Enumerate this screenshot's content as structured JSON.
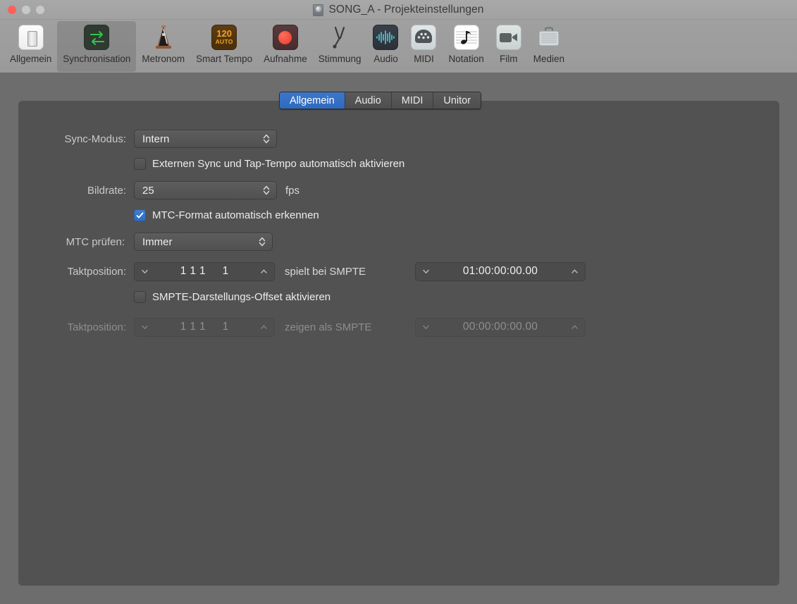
{
  "window": {
    "title": "SONG_A - Projekteinstellungen",
    "title_icon": "project-icon",
    "traffic_lights": [
      "close",
      "minimize",
      "maximize"
    ],
    "accent_color": "#3471c8",
    "panel_bg": "#525252",
    "toolbar_bg": "#9e9e9e"
  },
  "toolbar": {
    "items": [
      {
        "label": "Allgemein",
        "icon": "light-switch-icon",
        "selected": false
      },
      {
        "label": "Synchronisation",
        "icon": "sync-arrows-icon",
        "selected": true
      },
      {
        "label": "Metronom",
        "icon": "metronome-icon",
        "selected": false
      },
      {
        "label": "Smart Tempo",
        "icon": "tempo-120-auto-icon",
        "selected": false
      },
      {
        "label": "Aufnahme",
        "icon": "record-circle-icon",
        "selected": false
      },
      {
        "label": "Stimmung",
        "icon": "tuning-fork-icon",
        "selected": false
      },
      {
        "label": "Audio",
        "icon": "waveform-icon",
        "selected": false
      },
      {
        "label": "MIDI",
        "icon": "midi-din-icon",
        "selected": false
      },
      {
        "label": "Notation",
        "icon": "music-note-staff-icon",
        "selected": false
      },
      {
        "label": "Film",
        "icon": "video-camera-icon",
        "selected": false
      },
      {
        "label": "Medien",
        "icon": "briefcase-icon",
        "selected": false
      }
    ],
    "smart_tempo_value": "120",
    "smart_tempo_mode": "AUTO"
  },
  "tabs": [
    {
      "label": "Allgemein",
      "active": true
    },
    {
      "label": "Audio",
      "active": false
    },
    {
      "label": "MIDI",
      "active": false
    },
    {
      "label": "Unitor",
      "active": false
    }
  ],
  "form": {
    "sync_mode": {
      "label": "Sync-Modus:",
      "value": "Intern"
    },
    "external_sync_checkbox": {
      "label": "Externen Sync und Tap-Tempo automatisch aktivieren",
      "checked": false
    },
    "frame_rate": {
      "label": "Bildrate:",
      "value": "25",
      "unit": "fps"
    },
    "mtc_auto_detect_checkbox": {
      "label": "MTC-Format automatisch erkennen",
      "checked": true
    },
    "mtc_check": {
      "label": "MTC prüfen:",
      "value": "Immer"
    },
    "bar_position_play": {
      "label": "Taktposition:",
      "bar": "1",
      "beat": "1",
      "division": "1",
      "ticks": "1",
      "middle_text": "spielt bei SMPTE",
      "smpte_value": "01:00:00:00.00",
      "enabled": true
    },
    "smpte_offset_checkbox": {
      "label": "SMPTE-Darstellungs-Offset aktivieren",
      "checked": false
    },
    "bar_position_display": {
      "label": "Taktposition:",
      "bar": "1",
      "beat": "1",
      "division": "1",
      "ticks": "1",
      "middle_text": "zeigen als SMPTE",
      "smpte_value": "00:00:00:00.00",
      "enabled": false
    }
  }
}
